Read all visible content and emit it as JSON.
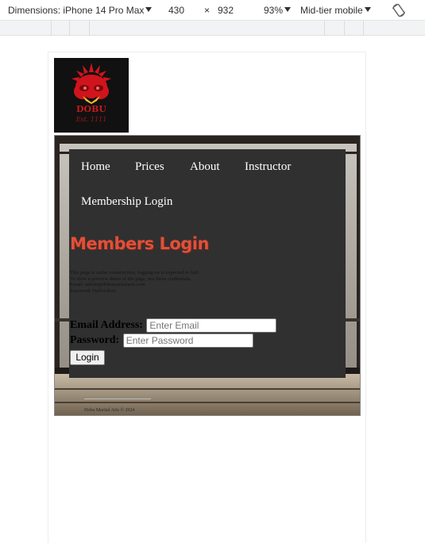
{
  "devtools": {
    "dimensions_label": "Dimensions: iPhone 14 Pro Max",
    "width": "430",
    "times": "×",
    "height": "932",
    "zoom": "93%",
    "throttle": "Mid-tier mobile"
  },
  "logo": {
    "brand": "DOBU",
    "tagline": "Est. 1111"
  },
  "nav": {
    "home": "Home",
    "prices": "Prices",
    "about": "About",
    "instructor": "Instructor",
    "membership_login": "Membership Login"
  },
  "page": {
    "title": "Members Login",
    "notice": [
      "This page is under construction, logging on is expected to fail!",
      "To view a preview demo of the page, use these credentials.",
      "Email: admin@dobumartialarts.com",
      "Password: HaDooKen"
    ]
  },
  "form": {
    "email_label": "Email Address:",
    "email_placeholder": "Enter Email",
    "password_label": "Password:",
    "password_placeholder": "Enter Password",
    "login_button": "Login"
  },
  "footer": {
    "text": "Dobu Martial Arts © 2024"
  }
}
